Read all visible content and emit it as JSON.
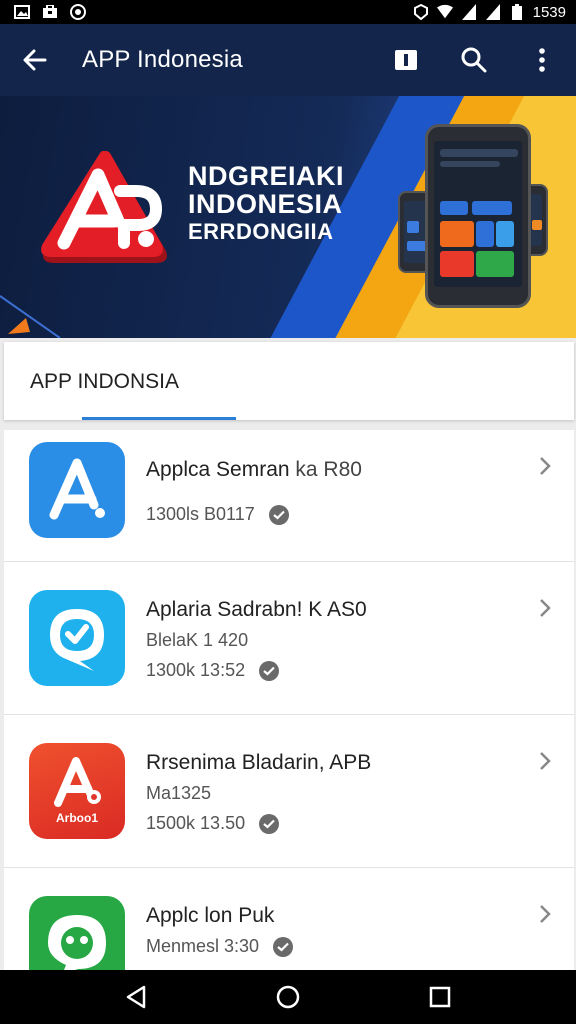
{
  "status_bar": {
    "time": "1539",
    "left_icons": [
      "image-icon",
      "briefcase-icon",
      "record-icon"
    ],
    "right_icons": [
      "vibrate-icon",
      "wifi-icon",
      "signal-icon",
      "signal-icon",
      "battery-icon"
    ]
  },
  "app_bar": {
    "title": "APP Indonesia",
    "background": "#13254a"
  },
  "banner": {
    "line1": "NDGREIAKI",
    "line2": "INDONESIA",
    "line3": "ERRDONGIIA"
  },
  "tab": {
    "label": "APP INDONSIA",
    "indicator_color": "#2c7fd6"
  },
  "items": [
    {
      "title": "Applca Semran",
      "title_suffix": "ka R80",
      "subtitle": "",
      "meta": "1300ls B0117",
      "icon": "letter-a-icon",
      "icon_color": "#2a8ee6"
    },
    {
      "title": "Aplaria Sadrabn! K AS0",
      "title_suffix": "",
      "subtitle": "BlelaK 1 420",
      "meta": "1300k 13:52",
      "icon": "chat-check-icon",
      "icon_color": "#1fb1ee"
    },
    {
      "title": "Rrsenima Bladarin, APB",
      "title_suffix": "",
      "subtitle": "Ma1325",
      "meta": "1500k 13.50",
      "icon": "letter-a-icon",
      "icon_color": "#e8432b",
      "icon_text": "Arboo1"
    },
    {
      "title": "Applc lon Puk",
      "title_suffix": "",
      "subtitle": "",
      "meta": "Menmesl 3:30",
      "icon": "chat-icon",
      "icon_color": "#27a844"
    }
  ]
}
